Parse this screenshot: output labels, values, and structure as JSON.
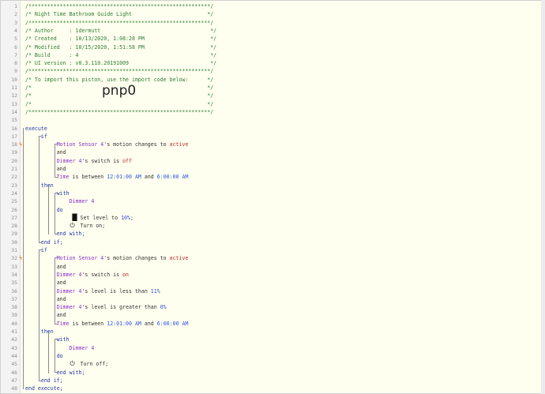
{
  "gutter": {
    "line_numbers": [
      "1",
      "2",
      "3",
      "4",
      "5",
      "6",
      "7",
      "8",
      "9",
      "10",
      "11",
      "12",
      "13",
      "14",
      "15",
      "16",
      "17",
      "18",
      "19",
      "20",
      "21",
      "22",
      "23",
      "24",
      "25",
      "26",
      "27",
      "28",
      "29",
      "30",
      "31",
      "32",
      "33",
      "34",
      "35",
      "36",
      "37",
      "38",
      "39",
      "40",
      "41",
      "42",
      "43",
      "44",
      "45",
      "46",
      "47",
      "48"
    ]
  },
  "header_comment": {
    "l1": "/**********************************************************/",
    "l2": "/* Night Time Bathroom Guide Light                        */",
    "l3": "/**********************************************************/",
    "l4": "/* Author     : 1dermutt                                   */",
    "l5": "/* Created    : 10/13/2020, 1:08:28 PM                     */",
    "l6": "/* Modified   : 10/15/2020, 1:51:58 PM                     */",
    "l7": "/* Build      : 4                                          */",
    "l8": "/* UI version : v0.3.110.20191009                          */",
    "l9": "/**********************************************************/",
    "l10": "/* To import this piston, use the import code below:      */",
    "l11": "/*                                                        */",
    "l12": "/*                                                        */",
    "l13": "/*                                                        */",
    "l14": "/**********************************************************/",
    "import_code": "pnp0"
  },
  "keywords": {
    "execute": "execute",
    "end_execute": "end execute;",
    "if": "if",
    "end_if": "end if;",
    "then": "then",
    "with": "with",
    "do": "do",
    "end_with": "end with;",
    "and": "and"
  },
  "block1": {
    "c1_device": "Motion Sensor 4",
    "c1_attr": "'s motion changes to ",
    "c1_value": "active",
    "c2_device": "Dimmer 4",
    "c2_attr": "'s switch is ",
    "c2_value": "off",
    "c3_subject": "Time",
    "c3_op": " is between ",
    "c3_from": "12:01:00 AM",
    "c3_and": " and ",
    "c3_to": "6:00:00 AM",
    "with_device": "Dimmer 4",
    "task1_text": "Set level to ",
    "task1_value": "10%",
    "task1_end": ";",
    "task2_text": "Turn on;"
  },
  "block2": {
    "c1_device": "Motion Sensor 4",
    "c1_attr": "'s motion changes to ",
    "c1_value": "active",
    "c2_device": "Dimmer 4",
    "c2_attr": "'s switch is ",
    "c2_value": "on",
    "c3_device": "Dimmer 4",
    "c3_attr": "'s level is less than ",
    "c3_value": "11%",
    "c4_device": "Dimmer 4",
    "c4_attr": "'s level is greater than ",
    "c4_value": "0%",
    "c5_subject": "Time",
    "c5_op": " is between ",
    "c5_from": "12:01:00 AM",
    "c5_and": " and ",
    "c5_to": "6:00:00 AM",
    "with_device": "Dimmer 4",
    "task1_text": "Turn off;"
  },
  "icons": {
    "trigger": "lightning-bolt-icon",
    "level": "signal-bars-icon",
    "power": "power-icon"
  },
  "colors": {
    "comment": "#2e7d32",
    "keyword": "#1f35a8",
    "device": "#8b2fc9",
    "value": "#c62828",
    "trigger": "#e05a00"
  }
}
